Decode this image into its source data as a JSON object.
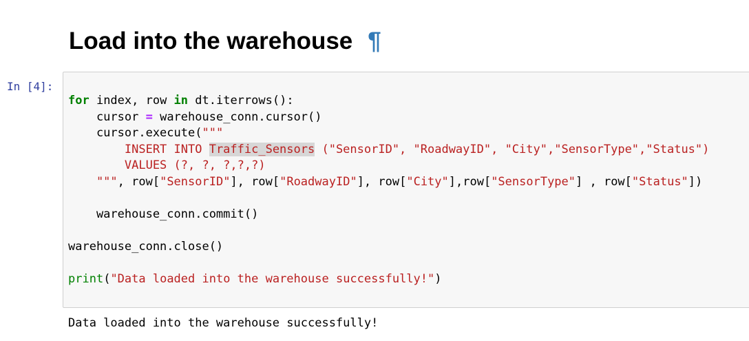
{
  "markdown": {
    "heading": "Load into the warehouse",
    "anchor_symbol": "¶"
  },
  "cell": {
    "prompt": "In [4]:",
    "code": {
      "l1": {
        "kw1": "for",
        "t1": " index, row ",
        "kw2": "in",
        "t2": " dt.iterrows():"
      },
      "l2": {
        "t1": "    cursor ",
        "op": "=",
        "t2": " warehouse_conn.cursor()"
      },
      "l3": {
        "t1": "    cursor.execute(",
        "s1": "\"\"\""
      },
      "l4": {
        "s1": "        INSERT INTO ",
        "sel": "Traffic_Sensors",
        "s2": " (\"SensorID\", \"RoadwayID\", \"City\",\"SensorType\",\"Status\")"
      },
      "l5": {
        "s1": "        VALUES (?, ?, ?,?,?)"
      },
      "l6": {
        "s1": "    \"\"\"",
        "t1": ", row[",
        "s2": "\"SensorID\"",
        "t2": "], row[",
        "s3": "\"RoadwayID\"",
        "t3": "], row[",
        "s4": "\"City\"",
        "t4": "],row[",
        "s5": "\"SensorType\"",
        "t5": "] , row[",
        "s6": "\"Status\"",
        "t6": "])"
      },
      "l8": {
        "t1": "    warehouse_conn.commit()"
      },
      "l10": {
        "t1": "warehouse_conn.close()"
      },
      "l12": {
        "kw1": "print",
        "t1": "(",
        "s1": "\"Data loaded into the warehouse successfully!\"",
        "t2": ")"
      }
    },
    "output": "Data loaded into the warehouse successfully!"
  },
  "colors": {
    "keyword": "#008000",
    "operator": "#aa22ff",
    "string": "#ba2121",
    "prompt": "#303f9f",
    "anchor": "#337ab7",
    "cell_background": "#f7f7f7",
    "cell_border": "#cfcfcf",
    "selection": "#d7d7d7"
  }
}
